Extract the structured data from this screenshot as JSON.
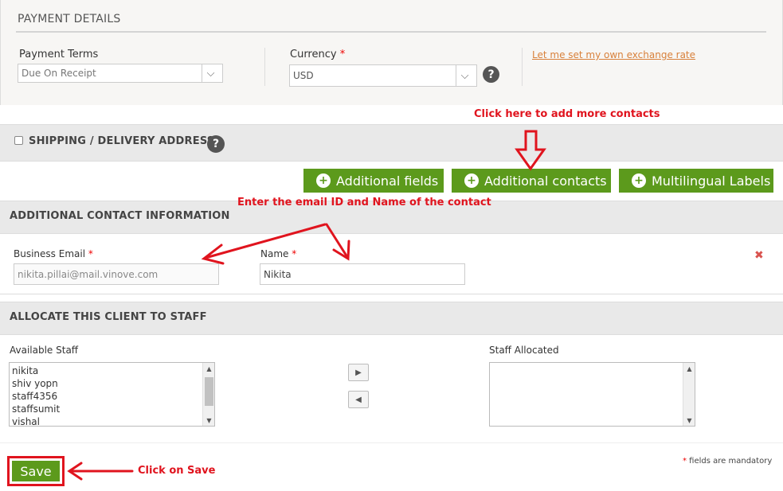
{
  "payment": {
    "title": "PAYMENT DETAILS",
    "terms_label": "Payment Terms",
    "terms_value": "Due On Receipt",
    "currency_label": "Currency",
    "currency_req": "*",
    "currency_value": "USD",
    "help_glyph": "?",
    "rate_link": "Let me set my own exchange rate"
  },
  "shipping": {
    "title": "SHIPPING / DELIVERY ADDRESS",
    "help_glyph": "?"
  },
  "buttons": {
    "additional_fields": "Additional fields",
    "additional_contacts": "Additional contacts",
    "multilingual": "Multilingual Labels",
    "plus_glyph": "+"
  },
  "contact": {
    "title": "ADDITIONAL CONTACT INFORMATION",
    "email_label": "Business Email",
    "email_req": "*",
    "email_value": "nikita.pillai@mail.vinove.com",
    "name_label": "Name",
    "name_req": "*",
    "name_value": "Nikita",
    "remove_glyph": "✖"
  },
  "staff": {
    "title": "ALLOCATE THIS CLIENT TO STAFF",
    "available_label": "Available Staff",
    "available": [
      "nikita",
      "shiv yopn",
      "staff4356",
      "staffsumit",
      "vishal"
    ],
    "allocated_label": "Staff Allocated",
    "move_right": "▶",
    "move_left": "◀"
  },
  "footer": {
    "save": "Save",
    "mandatory_star": "*",
    "mandatory_text": " fields are mandatory"
  },
  "annotations": {
    "contacts_hint": "Click here to add more contacts",
    "email_hint": "Enter the email ID and Name of the contact",
    "save_hint": "Click on Save"
  },
  "colors": {
    "accent_green": "#5c9a1c",
    "annotation_red": "#e0141e",
    "link_orange": "#d8803a"
  }
}
